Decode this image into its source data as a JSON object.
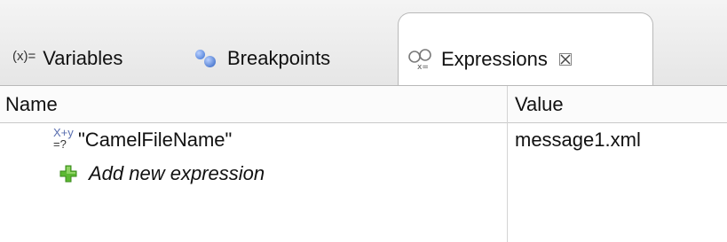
{
  "tabs": [
    {
      "prefix": "(x)=",
      "label": "Variables",
      "icon": "variables-icon",
      "active": false
    },
    {
      "label": "Breakpoints",
      "icon": "breakpoints-icon",
      "active": false
    },
    {
      "label": "Expressions",
      "icon": "expressions-icon",
      "active": true,
      "close_icon": "close-icon"
    }
  ],
  "table": {
    "columns": [
      "Name",
      "Value"
    ],
    "rows": [
      {
        "icon": "expression-item-icon",
        "icon_text_top": "X+y",
        "icon_text_bottom": "=?",
        "name": "\"CamelFileName\"",
        "value": "message1.xml"
      }
    ],
    "add_row": {
      "icon": "plus-icon",
      "label": "Add new expression"
    }
  },
  "colors": {
    "accent_blue": "#3a6fd1",
    "add_green": "#5cb832",
    "text": "#111111"
  }
}
